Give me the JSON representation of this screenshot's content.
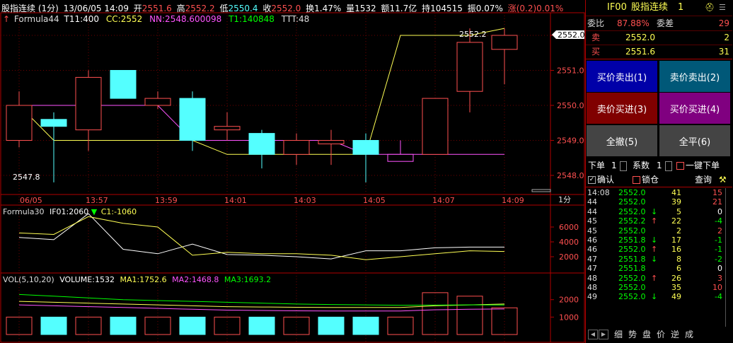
{
  "header": {
    "title": "股指连续 (1分)",
    "datetime": "13/06/05 14:09",
    "open_label": "开",
    "open": "2551.6",
    "high_label": "高",
    "high": "2552.2",
    "low_label": "低",
    "low": "2550.4",
    "close_label": "收",
    "close": "2552.0",
    "turnover_label": "换",
    "turnover": "1.47%",
    "volume_label": "量",
    "volume": "1532",
    "amount_label": "额",
    "amount": "11.7亿",
    "hold_label": "持",
    "hold": "104515",
    "amplitude_label": "振",
    "amplitude": "0.07%",
    "change_label": "涨",
    "change": "(0.2)0.01%"
  },
  "formula_main": {
    "name": "Formula44",
    "t11": "T11:400",
    "cc": "CC:2552",
    "nn": "NN:2548.600098",
    "t1": "T1:140848",
    "ttt": "TTT:48"
  },
  "price_axis": [
    "2552.0",
    "2551.0",
    "2550.0",
    "2549.0",
    "2548.0"
  ],
  "current_price_tag": "2552.0",
  "annotations": {
    "high": "2552.2",
    "low": "2547.8"
  },
  "time_axis": [
    "06/05",
    "13:57",
    "13:59",
    "14:01",
    "14:03",
    "14:05",
    "14:07",
    "14:09"
  ],
  "period_label": "1分",
  "formula_sub": {
    "name": "Formula30",
    "if01": "IF01:2060",
    "c1": "C1:-1060"
  },
  "sub_axis": [
    "6000",
    "4000",
    "2000"
  ],
  "vol_panel": {
    "title": "VOL(5,10,20)",
    "volume": "VOLUME:1532",
    "ma1": "MA1:1752.6",
    "ma2": "MA2:1468.8",
    "ma3": "MA3:1693.2"
  },
  "vol_axis": [
    "2000",
    "1000"
  ],
  "colors": {
    "up": "#ff5050",
    "down": "#54ffff",
    "yellow": "#ffff54",
    "magenta": "#ff54ff",
    "green": "#00ff00",
    "frame": "#b00000"
  },
  "chart_data": {
    "type": "candlestick",
    "price_range": [
      2547.8,
      2552.2
    ],
    "candles": [
      {
        "o": 2549.0,
        "h": 2550.4,
        "l": 2548.8,
        "c": 2550.0,
        "dir": "up"
      },
      {
        "o": 2549.6,
        "h": 2549.8,
        "l": 2547.8,
        "c": 2549.4,
        "dir": "down"
      },
      {
        "o": 2549.3,
        "h": 2551.0,
        "l": 2548.7,
        "c": 2550.8,
        "dir": "up"
      },
      {
        "o": 2551.0,
        "h": 2551.0,
        "l": 2550.2,
        "c": 2550.2,
        "dir": "down"
      },
      {
        "o": 2550.0,
        "h": 2550.4,
        "l": 2549.9,
        "c": 2550.2,
        "dir": "up"
      },
      {
        "o": 2550.2,
        "h": 2550.4,
        "l": 2548.7,
        "c": 2549.0,
        "dir": "down"
      },
      {
        "o": 2549.3,
        "h": 2549.8,
        "l": 2549.0,
        "c": 2549.4,
        "dir": "up"
      },
      {
        "o": 2549.2,
        "h": 2549.3,
        "l": 2548.2,
        "c": 2548.6,
        "dir": "down"
      },
      {
        "o": 2548.6,
        "h": 2549.2,
        "l": 2548.3,
        "c": 2549.0,
        "dir": "up"
      },
      {
        "o": 2549.0,
        "h": 2549.3,
        "l": 2548.3,
        "c": 2548.9,
        "dir": "up"
      },
      {
        "o": 2549.0,
        "h": 2549.2,
        "l": 2547.8,
        "c": 2548.6,
        "dir": "down"
      },
      {
        "o": 2548.4,
        "h": 2549.0,
        "l": 2548.4,
        "c": 2548.6,
        "dir": "flat"
      },
      {
        "o": 2548.6,
        "h": 2550.2,
        "l": 2548.6,
        "c": 2550.2,
        "dir": "up"
      },
      {
        "o": 2550.4,
        "h": 2552.2,
        "l": 2549.8,
        "c": 2551.8,
        "dir": "up"
      },
      {
        "o": 2551.6,
        "h": 2552.2,
        "l": 2550.6,
        "c": 2552.0,
        "dir": "up"
      }
    ],
    "yellow_line": [
      2550.0,
      2549.0,
      2549.0,
      2549.0,
      2549.0,
      2549.0,
      2548.6,
      2548.6,
      2548.6,
      2548.6,
      2548.6,
      2552.0,
      2552.0,
      2552.0,
      2552.2
    ],
    "magenta_line": [
      2550.0,
      2550.0,
      2550.0,
      2550.0,
      2550.0,
      2549.0,
      2549.0,
      2549.0,
      2549.0,
      2549.0,
      2548.6,
      2548.6,
      2548.6,
      2548.6,
      2548.6
    ],
    "sub_white": [
      4600,
      4300,
      7800,
      3000,
      2400,
      3700,
      2300,
      2200,
      2000,
      1700,
      2800,
      2800,
      3200,
      3300,
      3300
    ],
    "sub_yellow": [
      5200,
      5000,
      7400,
      6500,
      6000,
      2200,
      2600,
      2400,
      2400,
      2200,
      1600,
      2000,
      2400,
      2800,
      2700
    ],
    "sub_range": [
      0,
      8000
    ],
    "volumes": [
      1000,
      1000,
      1000,
      1000,
      1000,
      1000,
      1000,
      1000,
      1000,
      1000,
      1000,
      1000,
      2400,
      2200,
      1532
    ],
    "vol_dirs": [
      "up",
      "down",
      "up",
      "down",
      "up",
      "down",
      "up",
      "down",
      "up",
      "down",
      "down",
      "up",
      "up",
      "up",
      "up"
    ],
    "vol_range": [
      0,
      2800
    ],
    "vol_ma1": [
      1900,
      1850,
      1800,
      1750,
      1700,
      1650,
      1600,
      1580,
      1560,
      1550,
      1550,
      1550,
      1650,
      1700,
      1752
    ],
    "vol_ma2": [
      1700,
      1650,
      1600,
      1550,
      1500,
      1450,
      1400,
      1380,
      1360,
      1350,
      1350,
      1350,
      1420,
      1450,
      1468
    ],
    "vol_ma3": [
      2300,
      2200,
      2100,
      2000,
      1950,
      1900,
      1850,
      1800,
      1750,
      1720,
      1700,
      1680,
      1690,
      1700,
      1693
    ]
  },
  "panel": {
    "code": "IF00",
    "name": "股指连续",
    "num": "1",
    "ratio_label": "委比",
    "ratio": "87.88%",
    "diff_label": "委差",
    "diff": "29",
    "sell_label": "卖",
    "sell_price": "2552.0",
    "sell_qty": "2",
    "buy_label": "买",
    "buy_price": "2551.6",
    "buy_qty": "31",
    "btn_buy_sell_out": "买价卖出(1)",
    "btn_sell_sell_out": "卖价卖出(2)",
    "btn_sell_buy_in": "卖价买进(3)",
    "btn_buy_buy_in": "买价买进(4)",
    "btn_cancel_all": "全撤(5)",
    "btn_close_all": "全平(6)",
    "order_label": "下单",
    "order_qty": "1",
    "factor_label": "系数",
    "factor_qty": "1",
    "one_key_label": "一键下单",
    "confirm_label": "确认",
    "lock_label": "锁仓",
    "query_label": "查询"
  },
  "ticks": [
    {
      "t": "14:08",
      "p": "2552.0",
      "a": "",
      "v": "41",
      "d": "15",
      "dc": "up"
    },
    {
      "t": "44",
      "p": "2552.0",
      "a": "",
      "v": "39",
      "d": "21",
      "dc": "up"
    },
    {
      "t": "44",
      "p": "2552.0",
      "a": "↓",
      "v": "5",
      "d": "0",
      "dc": "zero"
    },
    {
      "t": "45",
      "p": "2552.2",
      "a": "↑",
      "v": "22",
      "d": "-4",
      "dc": "down"
    },
    {
      "t": "45",
      "p": "2552.0",
      "a": "",
      "v": "2",
      "d": "2",
      "dc": "up"
    },
    {
      "t": "46",
      "p": "2551.8",
      "a": "↓",
      "v": "17",
      "d": "-1",
      "dc": "down"
    },
    {
      "t": "46",
      "p": "2552.0",
      "a": "↑",
      "v": "16",
      "d": "-1",
      "dc": "down"
    },
    {
      "t": "47",
      "p": "2551.8",
      "a": "↓",
      "v": "8",
      "d": "-2",
      "dc": "down"
    },
    {
      "t": "47",
      "p": "2551.8",
      "a": "",
      "v": "6",
      "d": "0",
      "dc": "zero"
    },
    {
      "t": "48",
      "p": "2552.0",
      "a": "↑",
      "v": "26",
      "d": "3",
      "dc": "up"
    },
    {
      "t": "48",
      "p": "2552.0",
      "a": "",
      "v": "35",
      "d": "10",
      "dc": "up"
    },
    {
      "t": "49",
      "p": "2552.0",
      "a": "↓",
      "v": "49",
      "d": "-4",
      "dc": "down"
    }
  ],
  "bottom_tabs": [
    "细",
    "势",
    "盘",
    "价",
    "逆",
    "成"
  ]
}
